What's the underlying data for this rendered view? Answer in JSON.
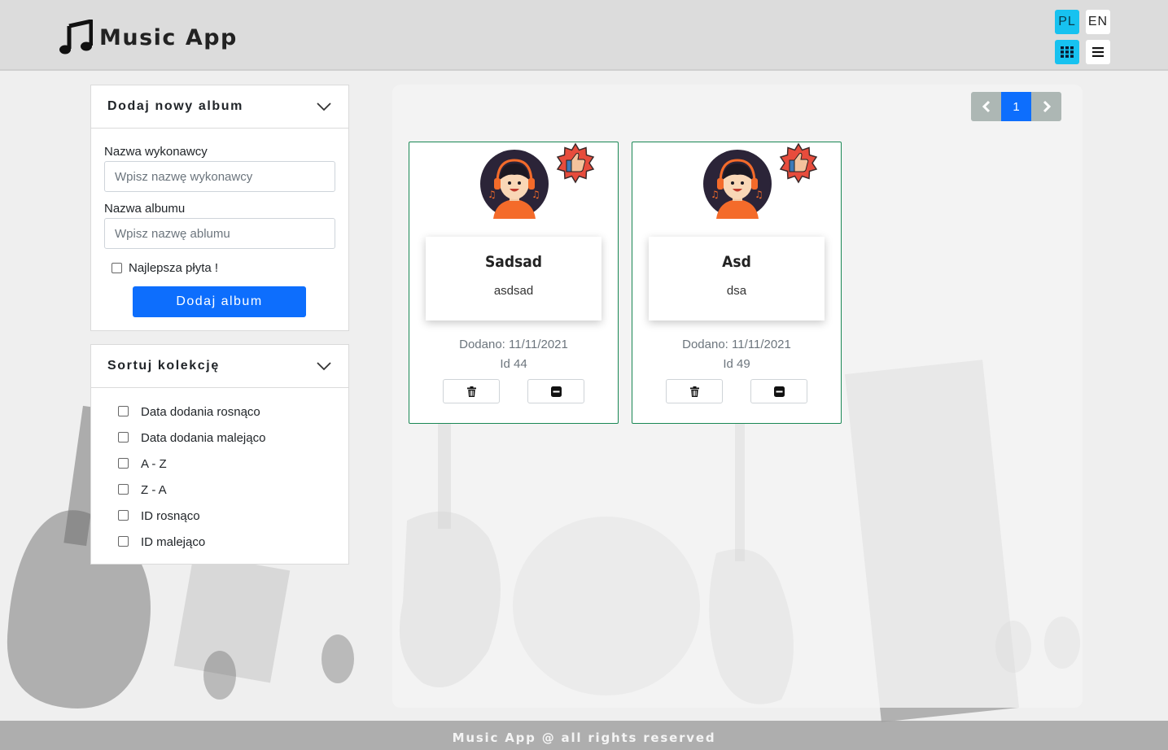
{
  "app": {
    "title": "Music App"
  },
  "header": {
    "languages": [
      {
        "code": "PL",
        "active": true
      },
      {
        "code": "EN",
        "active": false
      }
    ],
    "view_modes": [
      {
        "icon": "grid-icon",
        "active": true
      },
      {
        "icon": "list-icon",
        "active": false
      }
    ]
  },
  "add_album_panel": {
    "title": "Dodaj nowy album",
    "artist_label": "Nazwa wykonawcy",
    "artist_value": "",
    "artist_placeholder": "Wpisz nazwę wykonawcy",
    "album_label": "Nazwa albumu",
    "album_value": "",
    "album_placeholder": "Wpisz nazwę ablumu",
    "best_label": "Najlepsza płyta !",
    "best_checked": false,
    "submit_label": "Dodaj album"
  },
  "sort_panel": {
    "title": "Sortuj kolekcję",
    "options": [
      {
        "label": "Data dodania rosnąco",
        "checked": false
      },
      {
        "label": "Data dodania malejąco",
        "checked": false
      },
      {
        "label": "A - Z",
        "checked": false
      },
      {
        "label": "Z - A",
        "checked": false
      },
      {
        "label": "ID rosnąco",
        "checked": false
      },
      {
        "label": "ID malejąco",
        "checked": false
      }
    ]
  },
  "pagination": {
    "current_page": "1"
  },
  "albums": [
    {
      "artist": "Sadsad",
      "album": "asdsad",
      "date": "Dodano: 11/11/2021",
      "id": "Id 44",
      "favorite": true
    },
    {
      "artist": "Asd",
      "album": "dsa",
      "date": "Dodano: 11/11/2021",
      "id": "Id 49",
      "favorite": true
    }
  ],
  "colors": {
    "primary": "#0d6efd",
    "active_toggle": "#17c2f0",
    "card_border": "#198754",
    "pagination_arrow": "#adb7b4"
  },
  "footer": {
    "text": "Music App @ all rights reserved"
  }
}
